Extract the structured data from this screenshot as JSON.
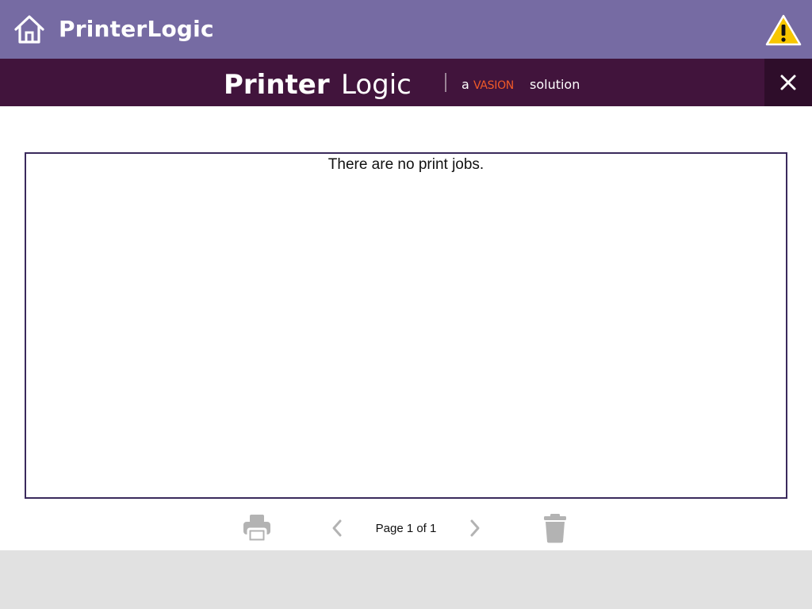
{
  "header": {
    "title": "PrinterLogic",
    "home_icon": "home-icon",
    "warning_icon": "warning-icon"
  },
  "banner": {
    "brand_printer": "Printer",
    "brand_logic": "Logic",
    "tagline_a": "a",
    "tagline_vasion": "VASION",
    "tagline_solution": "solution",
    "close_icon": "close-icon"
  },
  "jobs": {
    "empty_message": "There are no print jobs."
  },
  "pagination": {
    "label": "Page 1 of 1"
  },
  "toolbar": {
    "print_icon": "printer-icon",
    "prev_icon": "chevron-left-icon",
    "next_icon": "chevron-right-icon",
    "delete_icon": "trash-icon"
  },
  "colors": {
    "header_bg": "#766ba3",
    "banner_bg": "#41143c",
    "close_bg": "#2e0d2a",
    "accent_orange": "#f05a28",
    "warning_yellow": "#f7c600",
    "disabled_icon": "#b3b3b3",
    "footer_bg": "#e1e1e1"
  }
}
